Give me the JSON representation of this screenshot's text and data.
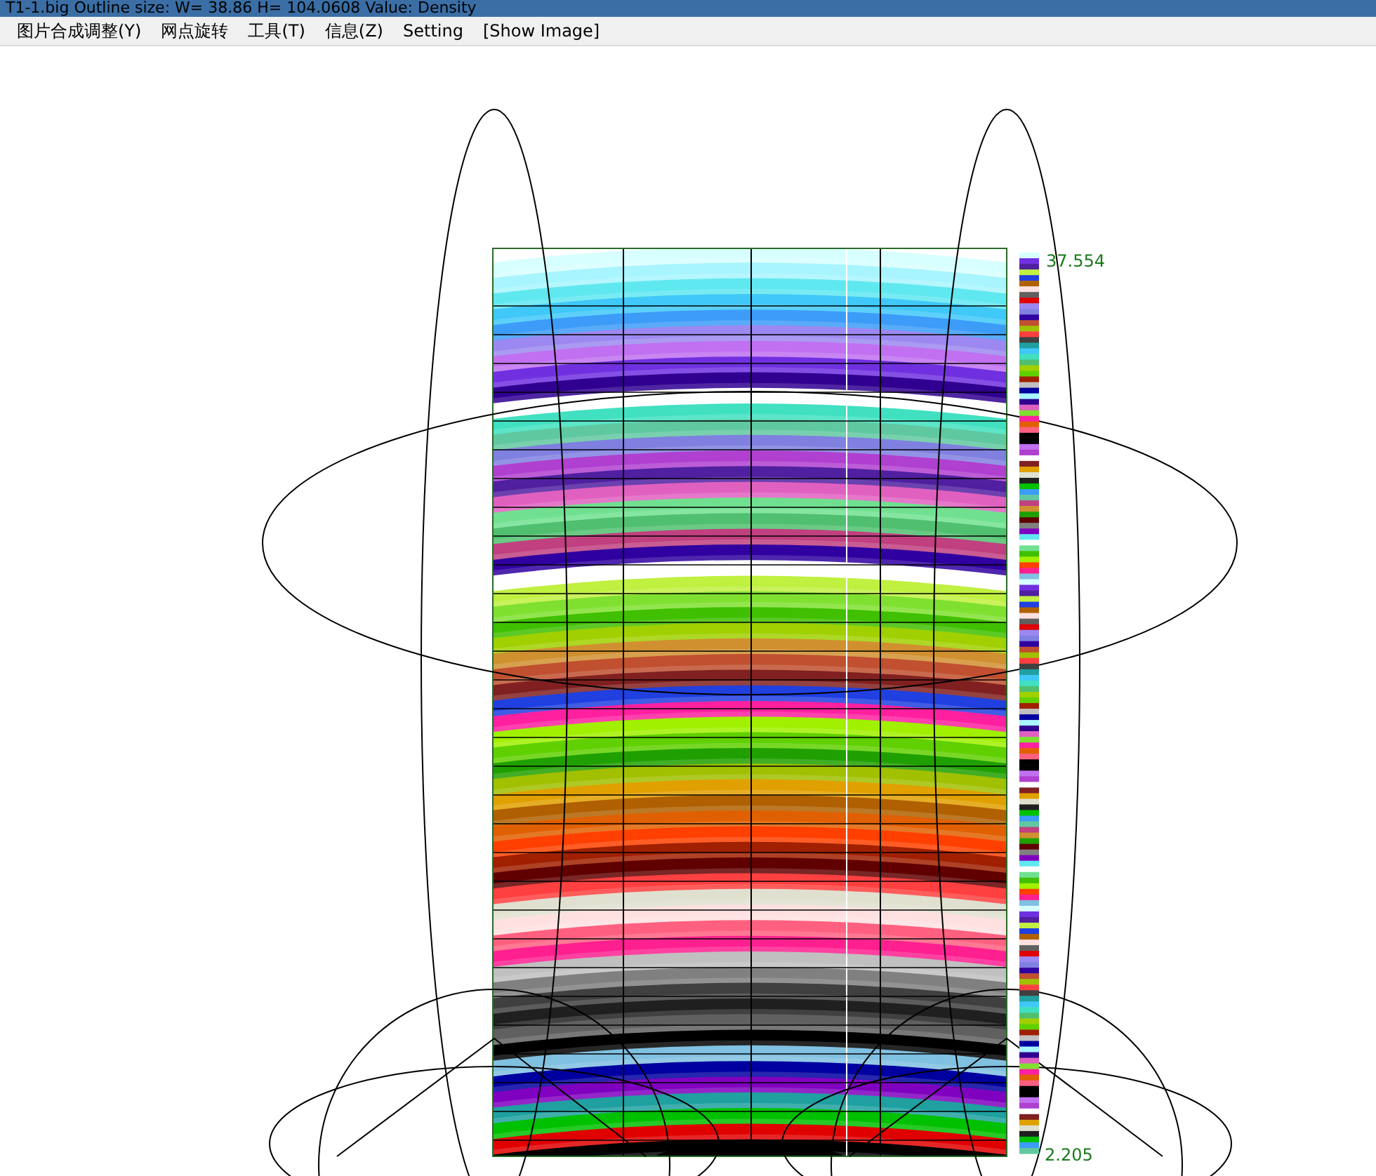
{
  "window": {
    "title": "T1-1.big    Outline size: W= 38.86  H= 104.0608  Value: Density"
  },
  "menu": [
    "图片合成调整(Y)",
    "网点旋转",
    "工具(T)",
    "信息(Z)",
    "Setting",
    "[Show Image]"
  ],
  "legend": {
    "max_label": "37.554",
    "min_label": "2.205"
  }
}
